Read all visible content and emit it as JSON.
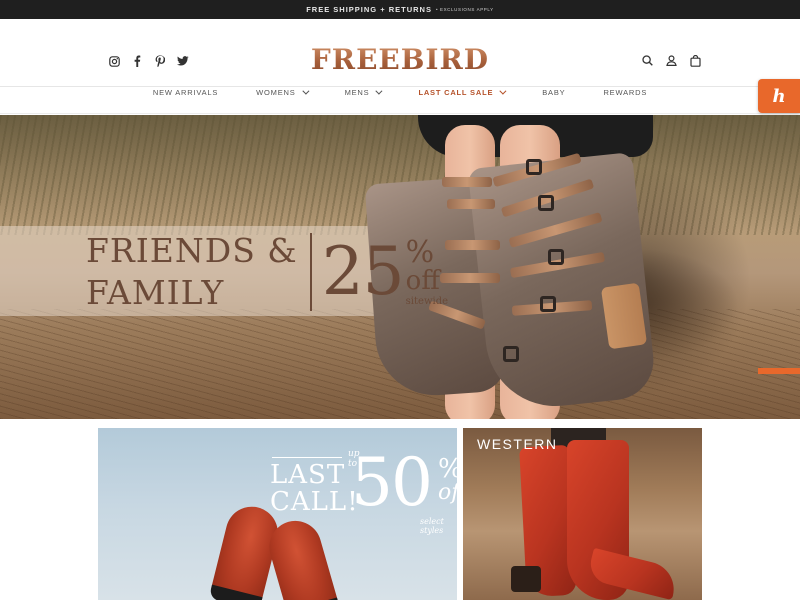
{
  "announcement": {
    "main": "FREE SHIPPING + RETURNS",
    "sub": "• EXCLUSIONS APPLY"
  },
  "header": {
    "logo": "FREEBIRD",
    "social_icons": [
      "instagram-icon",
      "facebook-icon",
      "pinterest-icon",
      "twitter-icon"
    ],
    "utility_icons": [
      "search-icon",
      "account-icon",
      "bag-icon"
    ]
  },
  "nav": {
    "items": [
      {
        "label": "NEW ARRIVALS",
        "dropdown": false
      },
      {
        "label": "WOMENS",
        "dropdown": true
      },
      {
        "label": "MENS",
        "dropdown": true
      },
      {
        "label": "LAST CALL SALE",
        "dropdown": true,
        "highlight": true
      },
      {
        "label": "BABY",
        "dropdown": false
      },
      {
        "label": "REWARDS",
        "dropdown": false
      }
    ]
  },
  "honey": {
    "glyph": "h"
  },
  "hero": {
    "line1": "FRIENDS &",
    "line2": "FAMILY",
    "percent": "25",
    "percent_sign": "%",
    "off": "off",
    "sitewide": "sitewide"
  },
  "tiles": {
    "last_call": {
      "up_to": "up to",
      "line1": "LAST",
      "line2": "CALL!",
      "percent": "50",
      "percent_sign": "%",
      "off": "off",
      "select": "select styles"
    },
    "western": {
      "label": "WESTERN"
    }
  },
  "colors": {
    "accent": "#b5522a",
    "honey": "#e8682b",
    "logo": "#b86e49",
    "announcement_bg": "#1f1f1f"
  }
}
